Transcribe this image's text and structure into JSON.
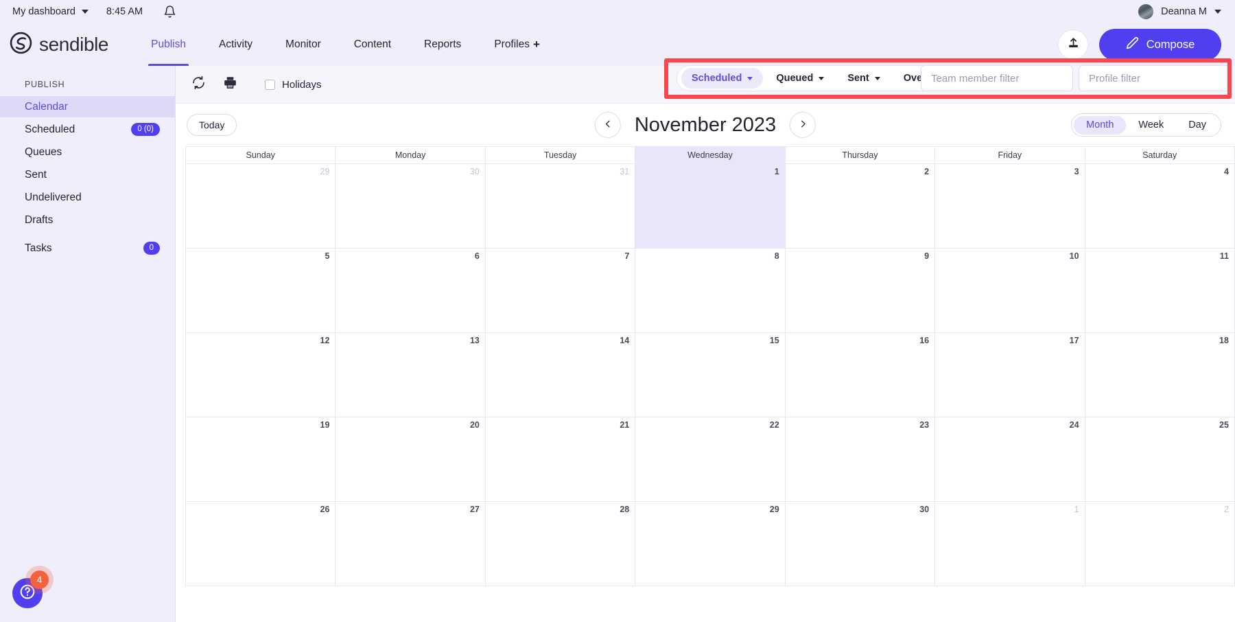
{
  "utility_bar": {
    "dashboard_label": "My dashboard",
    "time": "8:45 AM",
    "bell_icon": "bell-icon",
    "user_name": "Deanna M"
  },
  "brand": {
    "name": "sendible",
    "logo_icon": "sendible-logo-icon"
  },
  "nav": {
    "items": [
      {
        "label": "Publish",
        "active": true
      },
      {
        "label": "Activity",
        "active": false
      },
      {
        "label": "Monitor",
        "active": false
      },
      {
        "label": "Content",
        "active": false
      },
      {
        "label": "Reports",
        "active": false
      },
      {
        "label": "Profiles",
        "active": false,
        "suffix": "+"
      }
    ],
    "upload_icon": "upload-icon",
    "compose_label": "Compose",
    "compose_icon": "pencil-icon"
  },
  "sidebar": {
    "section_title": "PUBLISH",
    "items": [
      {
        "label": "Calendar",
        "badge": null,
        "active": true
      },
      {
        "label": "Scheduled",
        "badge": "0 (0)",
        "active": false
      },
      {
        "label": "Queues",
        "badge": null,
        "active": false
      },
      {
        "label": "Sent",
        "badge": null,
        "active": false
      },
      {
        "label": "Undelivered",
        "badge": null,
        "active": false
      },
      {
        "label": "Drafts",
        "badge": null,
        "active": false
      },
      {
        "label": "Tasks",
        "badge": "0",
        "active": false
      }
    ]
  },
  "toolbar": {
    "refresh_icon": "refresh-icon",
    "print_icon": "print-icon",
    "holidays_label": "Holidays",
    "holidays_checked": false
  },
  "filters": {
    "chips": [
      {
        "label": "Scheduled",
        "active": true
      },
      {
        "label": "Queued",
        "active": false
      },
      {
        "label": "Sent",
        "active": false
      },
      {
        "label": "Overview",
        "active": false
      }
    ],
    "team_member_placeholder": "Team member filter",
    "team_member_value": "",
    "profile_placeholder": "Profile filter",
    "profile_value": "",
    "highlight_color": "#f8484e"
  },
  "calendar": {
    "today_label": "Today",
    "prev_icon": "chevron-left-icon",
    "next_icon": "chevron-right-icon",
    "month_title": "November 2023",
    "views": [
      {
        "label": "Month",
        "active": true
      },
      {
        "label": "Week",
        "active": false
      },
      {
        "label": "Day",
        "active": false
      }
    ],
    "day_headers": [
      "Sunday",
      "Monday",
      "Tuesday",
      "Wednesday",
      "Thursday",
      "Friday",
      "Saturday"
    ],
    "today_column_index": 3,
    "weeks": [
      [
        {
          "day": "29",
          "other": true,
          "today": false
        },
        {
          "day": "30",
          "other": true,
          "today": false
        },
        {
          "day": "31",
          "other": true,
          "today": false
        },
        {
          "day": "1",
          "other": false,
          "today": true
        },
        {
          "day": "2",
          "other": false,
          "today": false
        },
        {
          "day": "3",
          "other": false,
          "today": false
        },
        {
          "day": "4",
          "other": false,
          "today": false
        }
      ],
      [
        {
          "day": "5",
          "other": false,
          "today": false
        },
        {
          "day": "6",
          "other": false,
          "today": false
        },
        {
          "day": "7",
          "other": false,
          "today": false
        },
        {
          "day": "8",
          "other": false,
          "today": false
        },
        {
          "day": "9",
          "other": false,
          "today": false
        },
        {
          "day": "10",
          "other": false,
          "today": false
        },
        {
          "day": "11",
          "other": false,
          "today": false
        }
      ],
      [
        {
          "day": "12",
          "other": false,
          "today": false
        },
        {
          "day": "13",
          "other": false,
          "today": false
        },
        {
          "day": "14",
          "other": false,
          "today": false
        },
        {
          "day": "15",
          "other": false,
          "today": false
        },
        {
          "day": "16",
          "other": false,
          "today": false
        },
        {
          "day": "17",
          "other": false,
          "today": false
        },
        {
          "day": "18",
          "other": false,
          "today": false
        }
      ],
      [
        {
          "day": "19",
          "other": false,
          "today": false
        },
        {
          "day": "20",
          "other": false,
          "today": false
        },
        {
          "day": "21",
          "other": false,
          "today": false
        },
        {
          "day": "22",
          "other": false,
          "today": false
        },
        {
          "day": "23",
          "other": false,
          "today": false
        },
        {
          "day": "24",
          "other": false,
          "today": false
        },
        {
          "day": "25",
          "other": false,
          "today": false
        }
      ],
      [
        {
          "day": "26",
          "other": false,
          "today": false
        },
        {
          "day": "27",
          "other": false,
          "today": false
        },
        {
          "day": "28",
          "other": false,
          "today": false
        },
        {
          "day": "29",
          "other": false,
          "today": false
        },
        {
          "day": "30",
          "other": false,
          "today": false
        },
        {
          "day": "1",
          "other": true,
          "today": false
        },
        {
          "day": "2",
          "other": true,
          "today": false
        }
      ]
    ]
  },
  "help": {
    "icon": "question-circle-icon",
    "badge_count": "4",
    "badge_color": "#f4613f"
  },
  "theme": {
    "accent": "#4f3ff0",
    "accent_light": "#5b4cdb",
    "header_bg": "#f0eefb",
    "today_cell": "#e9e6fa"
  }
}
